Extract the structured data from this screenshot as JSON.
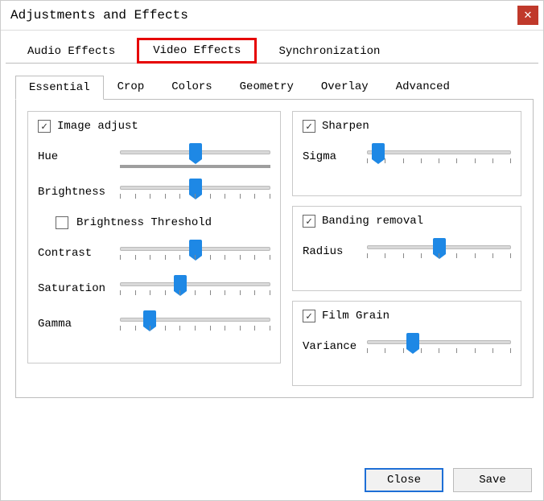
{
  "window": {
    "title": "Adjustments and Effects"
  },
  "main_tabs": {
    "audio": "Audio Effects",
    "video": "Video Effects",
    "sync": "Synchronization"
  },
  "sub_tabs": {
    "essential": "Essential",
    "crop": "Crop",
    "colors": "Colors",
    "geometry": "Geometry",
    "overlay": "Overlay",
    "advanced": "Advanced"
  },
  "image_adjust": {
    "title": "Image adjust",
    "hue": "Hue",
    "brightness": "Brightness",
    "brightness_threshold": "Brightness Threshold",
    "contrast": "Contrast",
    "saturation": "Saturation",
    "gamma": "Gamma"
  },
  "sharpen": {
    "title": "Sharpen",
    "sigma": "Sigma"
  },
  "banding": {
    "title": "Banding removal",
    "radius": "Radius"
  },
  "film_grain": {
    "title": "Film Grain",
    "variance": "Variance"
  },
  "buttons": {
    "close": "Close",
    "save": "Save"
  }
}
